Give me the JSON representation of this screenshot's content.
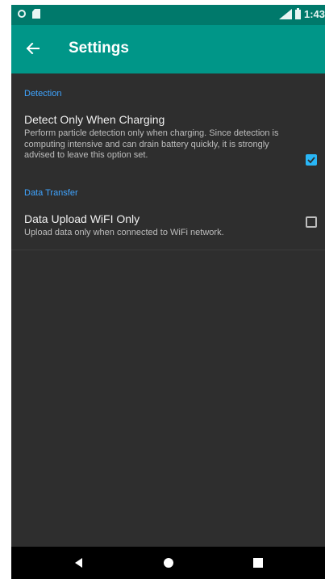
{
  "status_bar": {
    "time": "1:43",
    "icons": [
      "notification-circle-icon",
      "sd-card-icon",
      "signal-icon",
      "battery-icon"
    ]
  },
  "toolbar": {
    "back_icon": "arrow-left-icon",
    "title": "Settings"
  },
  "sections": [
    {
      "category": "Detection",
      "preference": {
        "title": "Detect Only When Charging",
        "summary": "Perform particle detection only when charging. Since detection is computing intensive and can drain battery quickly, it is strongly advised to leave this option set.",
        "checked": true
      }
    },
    {
      "category": "Data Transfer",
      "preference": {
        "title": "Data Upload WiFI Only",
        "summary": "Upload data only when connected to WiFi network.",
        "checked": false
      }
    }
  ],
  "nav_bar": {
    "buttons": [
      "back-triangle-icon",
      "home-circle-icon",
      "recents-square-icon"
    ]
  },
  "colors": {
    "status_bar": "#00796b",
    "toolbar": "#009688",
    "background": "#2e2e2e",
    "category_text": "#3fa4ff",
    "checkbox_checked": "#29b6f6"
  }
}
